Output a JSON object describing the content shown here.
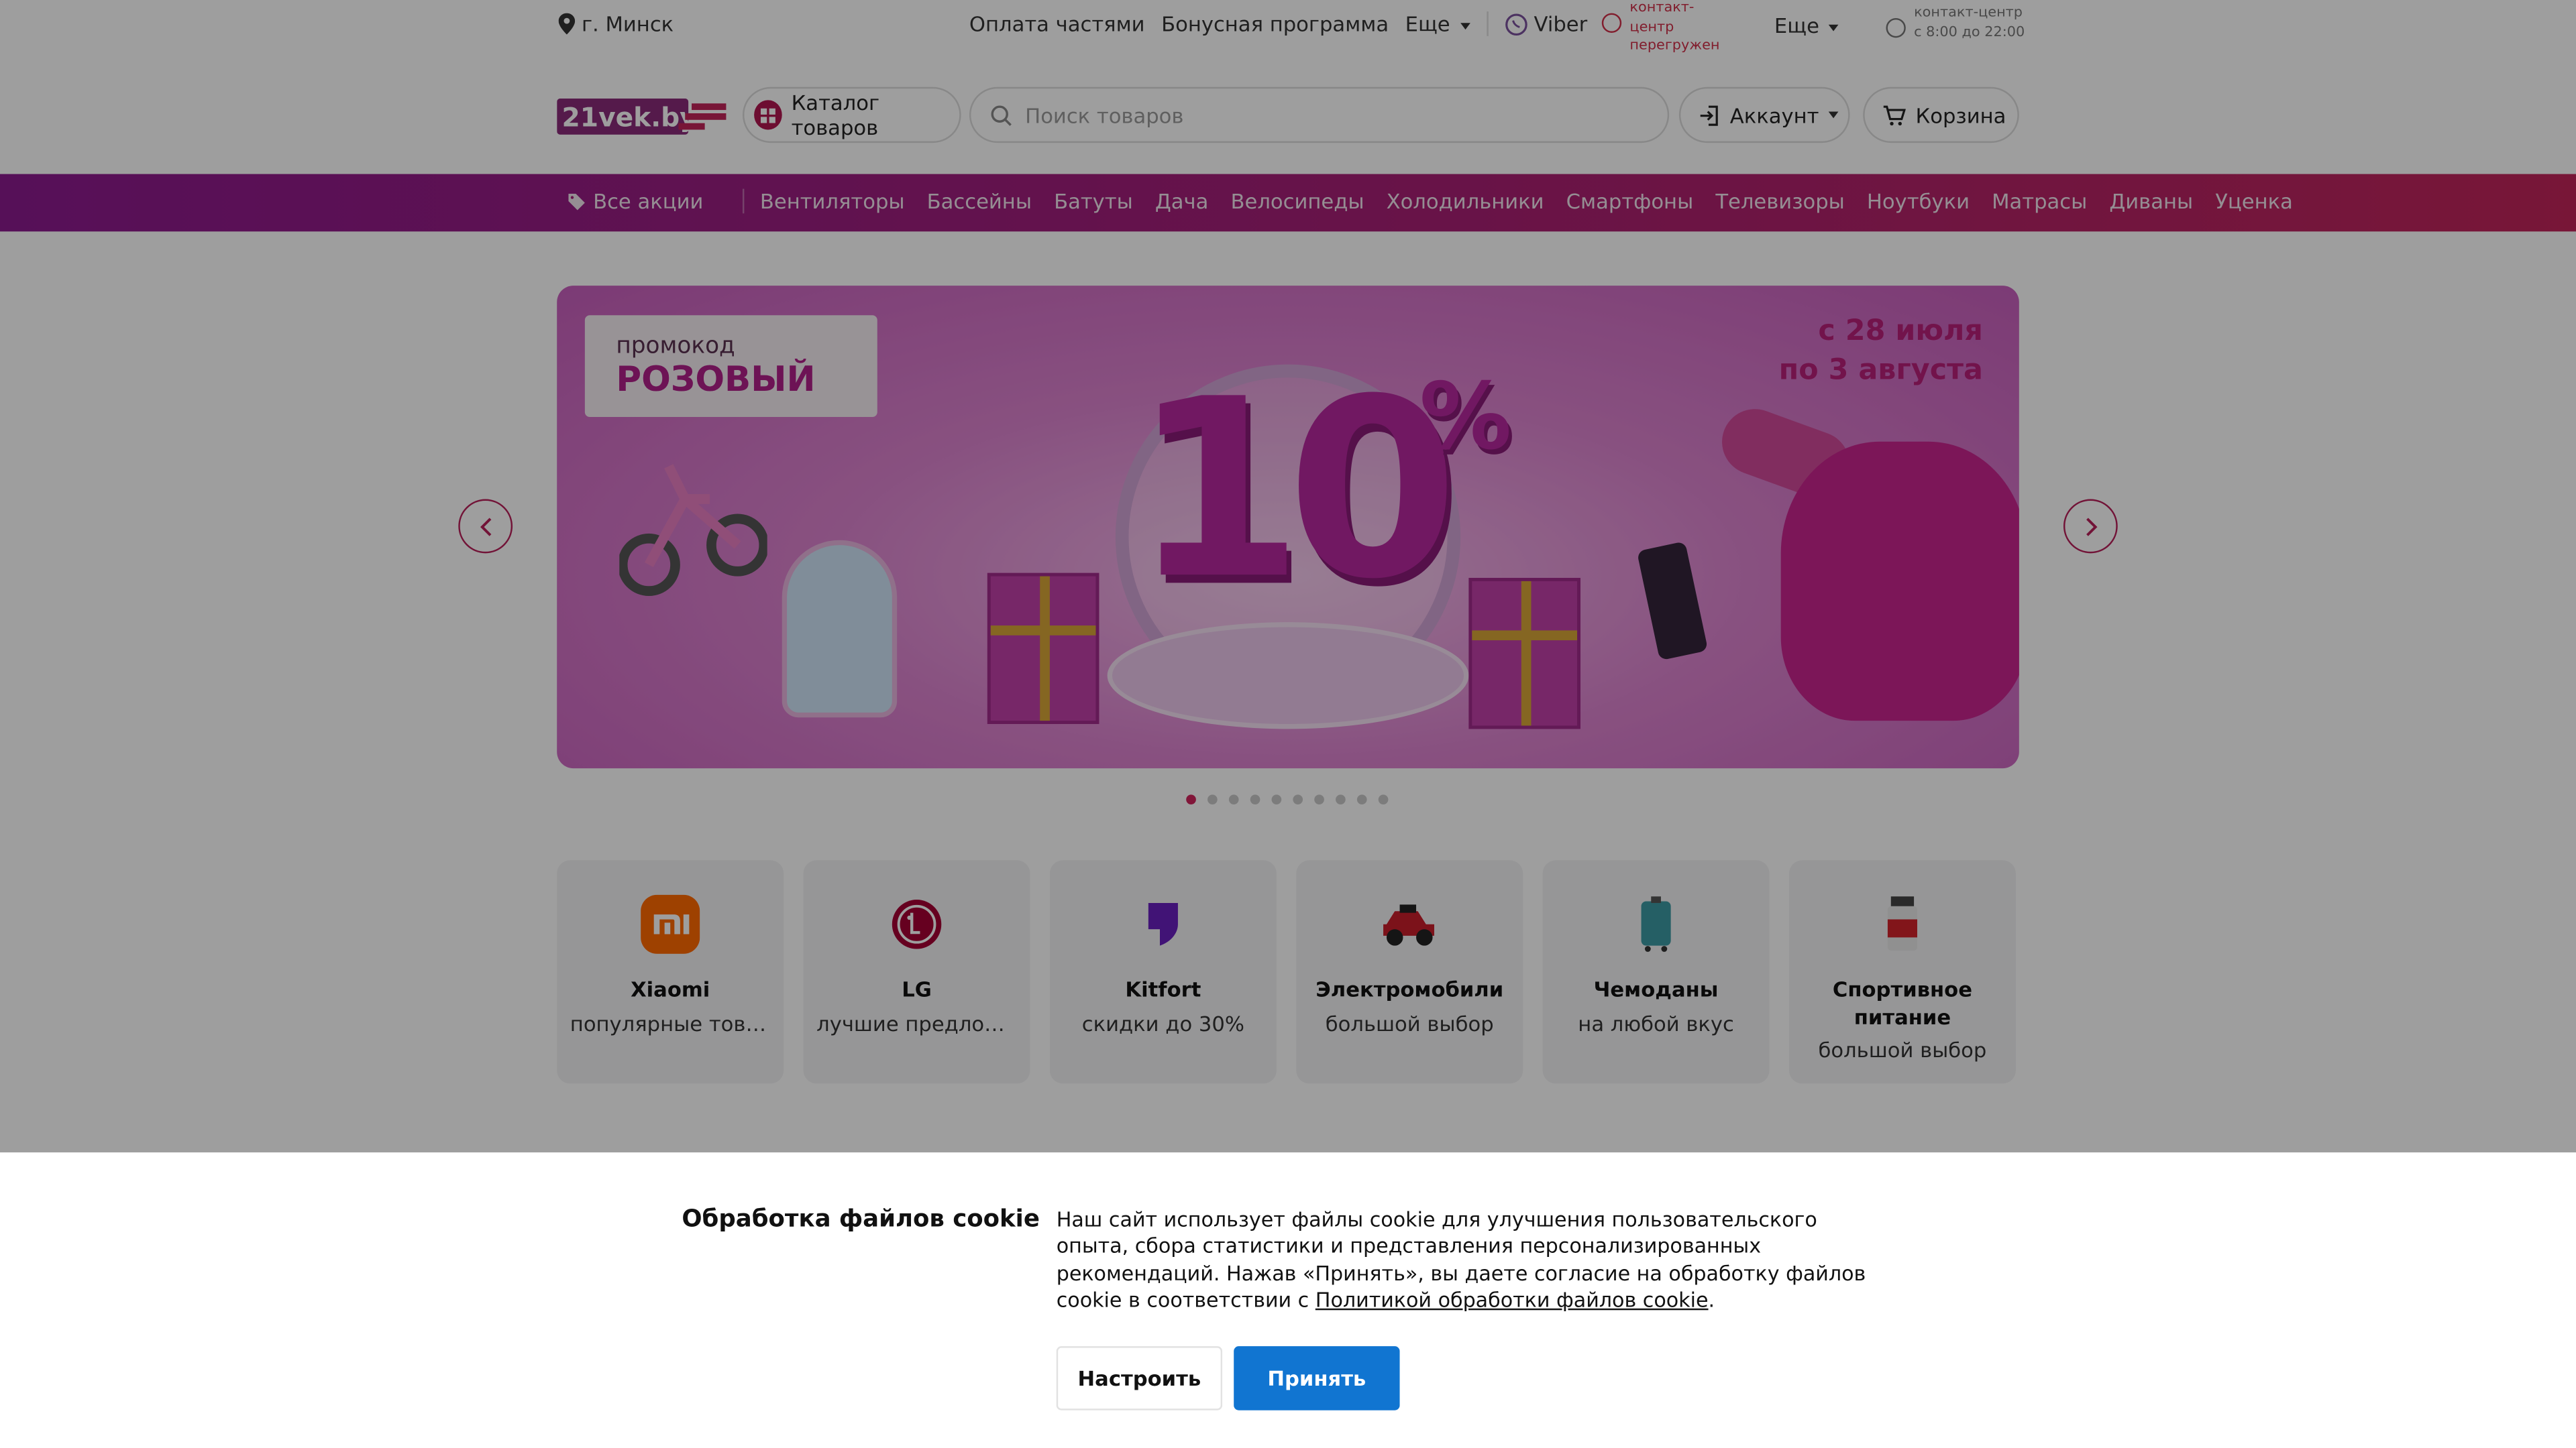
{
  "topbar": {
    "city": "г. Минск",
    "links": [
      "Оплата частями",
      "Бонусная программа"
    ],
    "more1": "Еще",
    "viber": "Viber",
    "warning": [
      "контакт-",
      "центр",
      "перегружен"
    ],
    "more2": "Еще",
    "contact": [
      "контакт-центр",
      "с 8:00 до 22:00"
    ]
  },
  "header": {
    "logo": "21vek.by",
    "catalog": "Каталог товаров",
    "search_placeholder": "Поиск товаров",
    "account": "Аккаунт",
    "cart": "Корзина"
  },
  "catnav": {
    "all": "Все акции",
    "items": [
      "Вентиляторы",
      "Бассейны",
      "Батуты",
      "Дача",
      "Велосипеды",
      "Холодильники",
      "Смартфоны",
      "Телевизоры",
      "Ноутбуки",
      "Матрасы",
      "Диваны",
      "Уценка"
    ]
  },
  "banner": {
    "promo_line1": "промокод",
    "promo_line2": "РОЗОВЫЙ",
    "dates_line1": "с 28 июля",
    "dates_line2": "по 3 августа",
    "big": "10",
    "pct": "%",
    "slides": 10,
    "active_slide": 1
  },
  "cards": [
    {
      "title": "Xiaomi",
      "sub": "популярные товары",
      "icon": "xiaomi-logo-icon"
    },
    {
      "title": "LG",
      "sub": "лучшие предложения",
      "icon": "lg-logo-icon"
    },
    {
      "title": "Kitfort",
      "sub": "скидки до 30%",
      "icon": "kitfort-logo-icon"
    },
    {
      "title": "Электромобили",
      "sub": "большой выбор",
      "icon": "electric-car-icon"
    },
    {
      "title": "Чемоданы",
      "sub": "на любой вкус",
      "icon": "suitcase-icon"
    },
    {
      "title": "Спортивное питание",
      "sub": "большой выбор",
      "icon": "sport-nutrition-icon"
    }
  ],
  "cookie": {
    "heading": "Обработка файлов cookie",
    "text": "Наш сайт использует файлы cookie для улучшения пользовательского опыта, сбора статистики и представления персонализированных рекомендаций. Нажав «Принять», вы даете согласие на обработку файлов cookie в соответствии с ",
    "link": "Политикой обработки файлов cookie",
    "text_end": ".",
    "btn_settings": "Настроить",
    "btn_accept": "Принять"
  },
  "colors": {
    "brand": "#b0164f",
    "accept": "#1175d1",
    "nav_start": "#8c1a8f",
    "nav_end": "#c2255a"
  }
}
